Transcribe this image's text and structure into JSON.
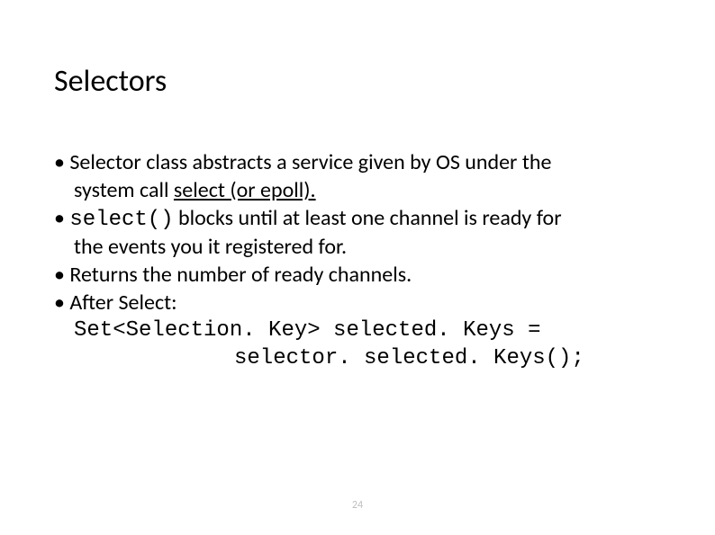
{
  "slide": {
    "title": "Selectors",
    "bullets": {
      "b1_line1_a": "• Selector class abstracts a service given by OS under the",
      "b1_line2_a": "system call ",
      "b1_line2_b": "select (or epoll).",
      "b2_a": "• ",
      "b2_code": "select()",
      "b2_b": " blocks until at least one channel is ready for",
      "b2_line2": "the events you it registered for.",
      "b3": "• Returns the number of ready channels.",
      "b4": "• After Select:",
      "b4_code1": "Set<Selection. Key> selected. Keys =",
      "b4_code2": "selector. selected. Keys();"
    },
    "page_number": "24"
  }
}
